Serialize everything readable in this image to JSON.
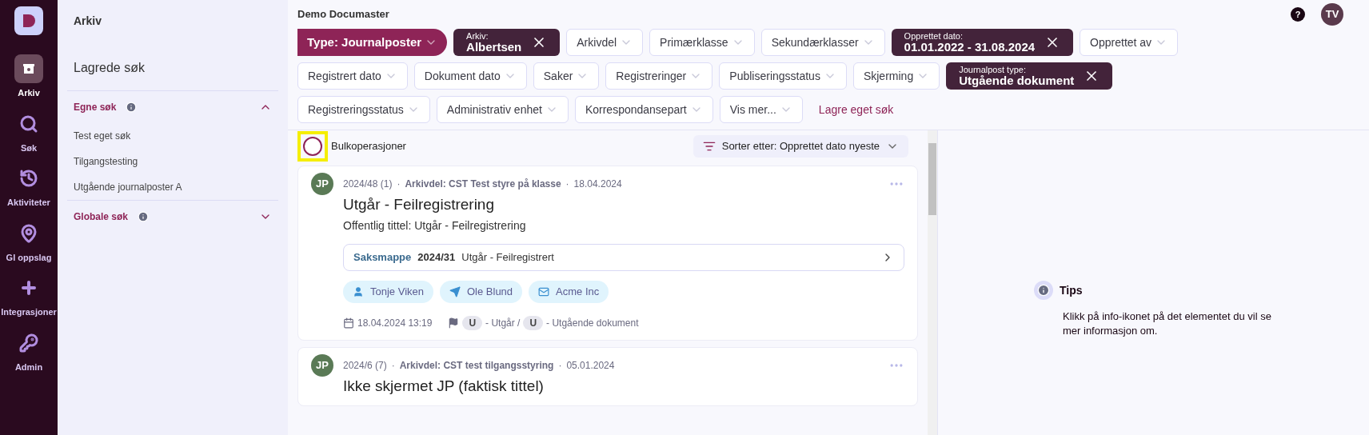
{
  "nav": {
    "items": [
      {
        "label": "Arkiv",
        "selected": true
      },
      {
        "label": "Søk",
        "selected": false
      },
      {
        "label": "Aktiviteter",
        "selected": false
      },
      {
        "label": "Gl oppslag",
        "selected": false
      },
      {
        "label": "Integrasjoner",
        "selected": false
      },
      {
        "label": "Admin",
        "selected": false
      }
    ]
  },
  "sidebar": {
    "title": "Arkiv",
    "heading": "Lagrede søk",
    "groups": [
      {
        "label": "Egne søk",
        "expanded": true,
        "items": [
          "Test eget søk",
          "Tilgangstesting",
          "Utgående journalposter A"
        ]
      },
      {
        "label": "Globale søk",
        "expanded": false
      }
    ]
  },
  "header": {
    "title": "Demo Documaster",
    "help": "?",
    "avatar": "TV"
  },
  "filter_rows": [
    [
      {
        "kind": "primary",
        "label": "Type: Journalposter"
      },
      {
        "kind": "active",
        "label": "Arkiv:",
        "value": "Albertsen"
      },
      {
        "kind": "dropdown",
        "label": "Arkivdel"
      },
      {
        "kind": "dropdown",
        "label": "Primærklasse"
      },
      {
        "kind": "dropdown",
        "label": "Sekundærklasser"
      },
      {
        "kind": "active",
        "label": "Opprettet dato:",
        "value": "01.01.2022 - 31.08.2024"
      },
      {
        "kind": "dropdown",
        "label": "Opprettet av"
      }
    ],
    [
      {
        "kind": "dropdown",
        "label": "Registrert dato"
      },
      {
        "kind": "dropdown",
        "label": "Dokument dato"
      },
      {
        "kind": "dropdown",
        "label": "Saker"
      },
      {
        "kind": "dropdown",
        "label": "Registreringer"
      },
      {
        "kind": "dropdown",
        "label": "Publiseringsstatus"
      },
      {
        "kind": "dropdown",
        "label": "Skjerming"
      },
      {
        "kind": "active",
        "label": "Journalpost type:",
        "value": "Utgående dokument"
      }
    ],
    [
      {
        "kind": "dropdown",
        "label": "Registreringsstatus"
      },
      {
        "kind": "dropdown",
        "label": "Administrativ enhet"
      },
      {
        "kind": "dropdown",
        "label": "Korrespondansepart"
      },
      {
        "kind": "dropdown",
        "label": "Vis mer..."
      },
      {
        "kind": "link",
        "label": "Lagre eget søk"
      }
    ]
  ],
  "bulk": {
    "label": "Bulkoperasjoner",
    "checked": false,
    "highlighted": true
  },
  "sort": {
    "label": "Sorter etter: Opprettet dato nyeste"
  },
  "results": [
    {
      "avatar": "JP",
      "number": "2024/48 (1)",
      "separators": [
        "·",
        "·"
      ],
      "series": "Arkivdel: CST Test styre på klasse",
      "date": "18.04.2024",
      "title": "Utgår - Feilregistrering",
      "public_title": "Offentlig tittel: Utgår - Feilregistrering",
      "case": {
        "label": "Saksmappe",
        "number": "2024/31",
        "title": "Utgår - Feilregistrert"
      },
      "parties": [
        {
          "kind": "person",
          "name": "Tonje Viken"
        },
        {
          "kind": "sender",
          "name": "Ole Blund"
        },
        {
          "kind": "mail",
          "name": "Acme Inc"
        }
      ],
      "created": "18.04.2024 13:19",
      "status_code": "U",
      "status": "- Utgår /",
      "type_code": "U",
      "type": "- Utgående dokument"
    },
    {
      "avatar": "JP",
      "number": "2024/6 (7)",
      "separators": [
        "·",
        "·"
      ],
      "series": "Arkivdel: CST test tilgangsstyring",
      "date": "05.01.2024",
      "title": "Ikke skjermet JP (faktisk tittel)"
    }
  ],
  "tips": {
    "title": "Tips",
    "text": "Klikk på info-ikonet på det elementet du vil se mer informasjon om."
  }
}
